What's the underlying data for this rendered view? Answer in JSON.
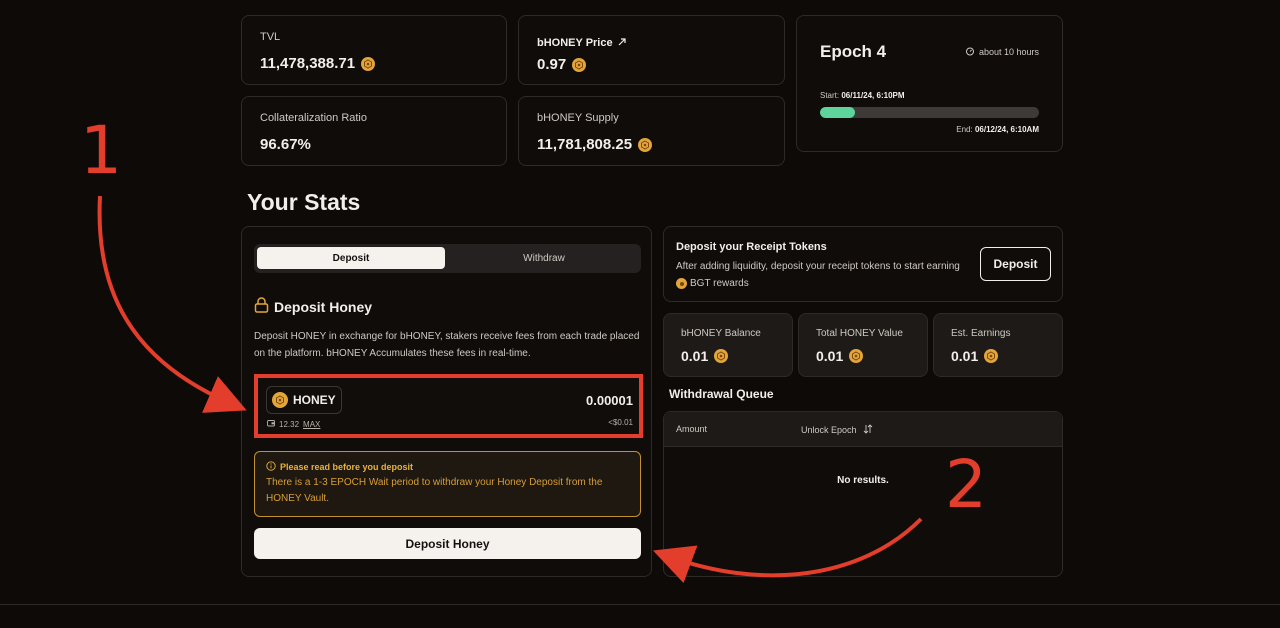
{
  "stats": {
    "tvl_label": "TVL",
    "tvl_value": "11,478,388.71",
    "price_label": "bHONEY Price",
    "price_value": "0.97",
    "collat_label": "Collateralization Ratio",
    "collat_value": "96.67%",
    "supply_label": "bHONEY Supply",
    "supply_value": "11,781,808.25"
  },
  "epoch": {
    "title": "Epoch 4",
    "eta": "about 10 hours",
    "start_label": "Start:",
    "start_value": "06/11/24, 6:10PM",
    "end_label": "End:",
    "end_value": "06/12/24, 6:10AM",
    "progress_percent": 16
  },
  "section_title": "Your Stats",
  "deposit": {
    "tab_deposit": "Deposit",
    "tab_withdraw": "Withdraw",
    "title": "Deposit Honey",
    "description": "Deposit HONEY in exchange for bHONEY, stakers receive fees from each trade placed on the platform. bHONEY Accumulates these fees in real-time.",
    "token": "HONEY",
    "amount": "0.00001",
    "balance": "12.32",
    "max_label": "MAX",
    "usd_value": "<$0.01",
    "notice_title": "Please read before you deposit",
    "notice_body": "There is a 1-3 EPOCH Wait period to withdraw your Honey Deposit from the HONEY Vault.",
    "button": "Deposit Honey"
  },
  "receipt": {
    "title": "Deposit your Receipt Tokens",
    "desc": "After adding liquidity, deposit your receipt tokens to start earning",
    "bgt": "BGT rewards",
    "button": "Deposit"
  },
  "mini": {
    "balance_label": "bHONEY Balance",
    "balance_value": "0.01",
    "total_label": "Total HONEY Value",
    "total_value": "0.01",
    "earn_label": "Est. Earnings",
    "earn_value": "0.01"
  },
  "queue": {
    "title": "Withdrawal Queue",
    "col_amount": "Amount",
    "col_epoch": "Unlock Epoch",
    "empty": "No results."
  },
  "annotations": {
    "one": "1",
    "two": "2",
    "color": "#e33d2b"
  },
  "colors": {
    "background": "#0d0a08",
    "honey": "#e3a53a",
    "progress": "#5ed39b",
    "warning": "#e8b13e"
  }
}
